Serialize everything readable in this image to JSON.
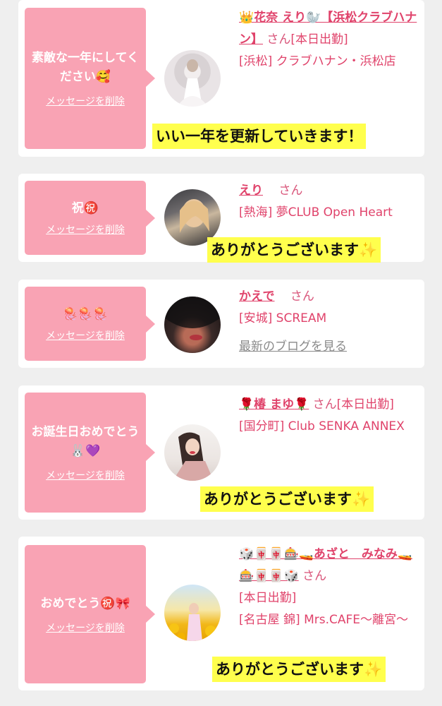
{
  "cards": [
    {
      "message": "素敵な一年にしてください🥰",
      "delete_label": "メッセージを削除",
      "name_pre": "👑",
      "name": "花奈 えり",
      "name_post": "🦭【浜松クラブハナン】",
      "san": "さん",
      "status": "[本日出勤]",
      "location": "[浜松] クラブハナン・浜松店",
      "reply": "いい一年を更新していきます！"
    },
    {
      "message": "祝㊗️",
      "delete_label": "メッセージを削除",
      "name": "えり",
      "san": "さん",
      "location": "[熱海] 夢CLUB Open Heart",
      "reply": "ありがとうございます✨"
    },
    {
      "message": "🪼🪼🪼",
      "delete_label": "メッセージを削除",
      "name": "かえで",
      "san": "さん",
      "location": "[安城] SCREAM",
      "blog_link": "最新のブログを見る"
    },
    {
      "message": "お誕生日おめでとう🐰💜",
      "delete_label": "メッセージを削除",
      "name_pre": "🌹",
      "name": "椿 まゆ",
      "name_post": "🌹",
      "san": "さん",
      "status": "[本日出勤]",
      "location": "[国分町] Club SENKA ANNEX",
      "reply": "ありがとうございます✨"
    },
    {
      "message": "おめでとう㊗️🎀",
      "delete_label": "メッセージを削除",
      "name_pre": "🎲🀄🀄🎰🚤",
      "name": "あざと　みなみ",
      "name_post": "🚤🎰🀄🀄🎲",
      "san": "さん",
      "status": "[本日出勤]",
      "location": "[名古屋 錦] Mrs.CAFE〜離宮〜",
      "reply": "ありがとうございます✨"
    }
  ],
  "colors": {
    "bubble": "#f9a3b4",
    "accent": "#e0436b",
    "highlight": "#ffff4d",
    "background": "#efefef"
  }
}
